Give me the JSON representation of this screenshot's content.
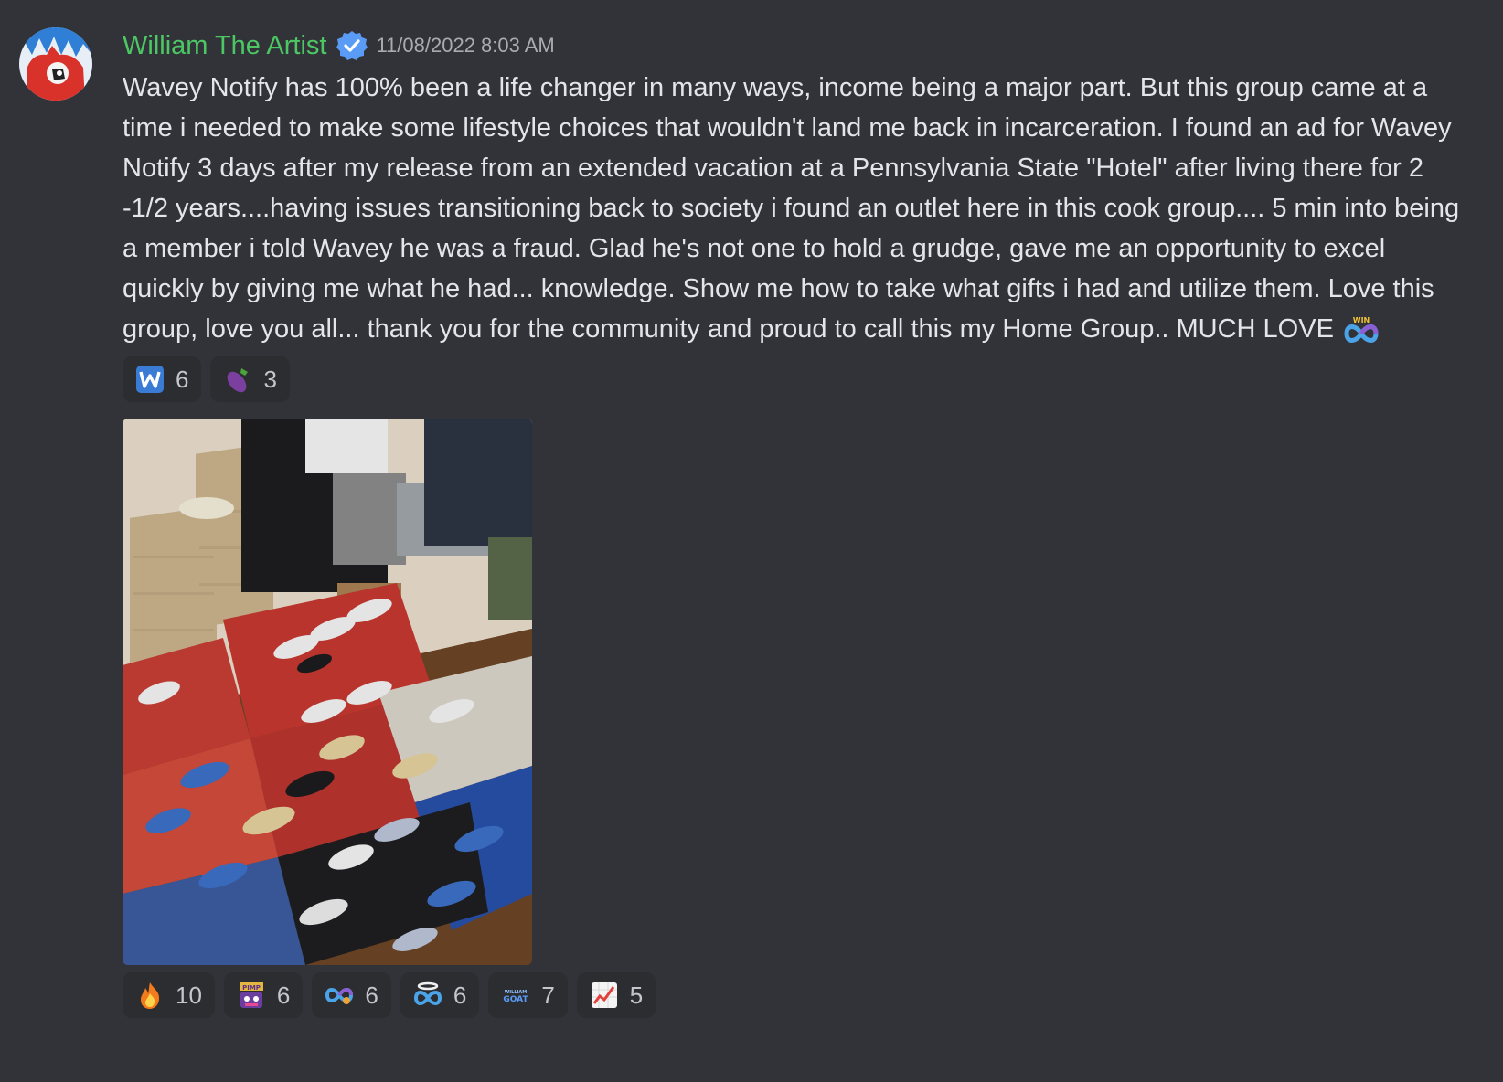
{
  "message": {
    "author": "William The Artist",
    "timestamp": "11/08/2022 8:03 AM",
    "text": "Wavey Notify has 100% been a life changer in many ways, income being a major part. But this group came at a time i needed to make some lifestyle choices that wouldn't land me back in incarceration. I found an ad for Wavey Notify 3 days after my release from an extended vacation at a Pennsylvania State \"Hotel\" after living there for 2 -1/2  years....having issues transitioning back to society i found an outlet here in this cook group.... 5 min into being a member i told Wavey he was a fraud. Glad he's not one to hold a grudge, gave me an opportunity to excel quickly by giving me what he had... knowledge. Show me how to take what gifts i had and utilize them. Love this group, love you all... thank you for the community and proud to call this my Home Group.. MUCH LOVE",
    "inline_emoji": "win-infinity-emoji",
    "text_reactions": [
      {
        "emoji": "w-letter-emoji",
        "count": "6"
      },
      {
        "emoji": "eggplant-emoji",
        "count": "3"
      }
    ],
    "image_reactions": [
      {
        "emoji": "fire-emoji",
        "count": "10"
      },
      {
        "emoji": "pimp-emoji",
        "count": "6"
      },
      {
        "emoji": "infinity-emoji",
        "count": "6"
      },
      {
        "emoji": "infinity-halo-emoji",
        "count": "6"
      },
      {
        "emoji": "william-goat-emoji",
        "count": "7"
      },
      {
        "emoji": "chart-up-emoji",
        "count": "5"
      }
    ],
    "emoji_labels": {
      "pimp": "PIMP",
      "win": "WIN",
      "william": "WILLIAM",
      "goat": "GOAT"
    }
  },
  "colors": {
    "background": "#313338",
    "username": "#4cc764",
    "reaction_bg": "#2b2d31",
    "verified": "#5a9cf5"
  }
}
